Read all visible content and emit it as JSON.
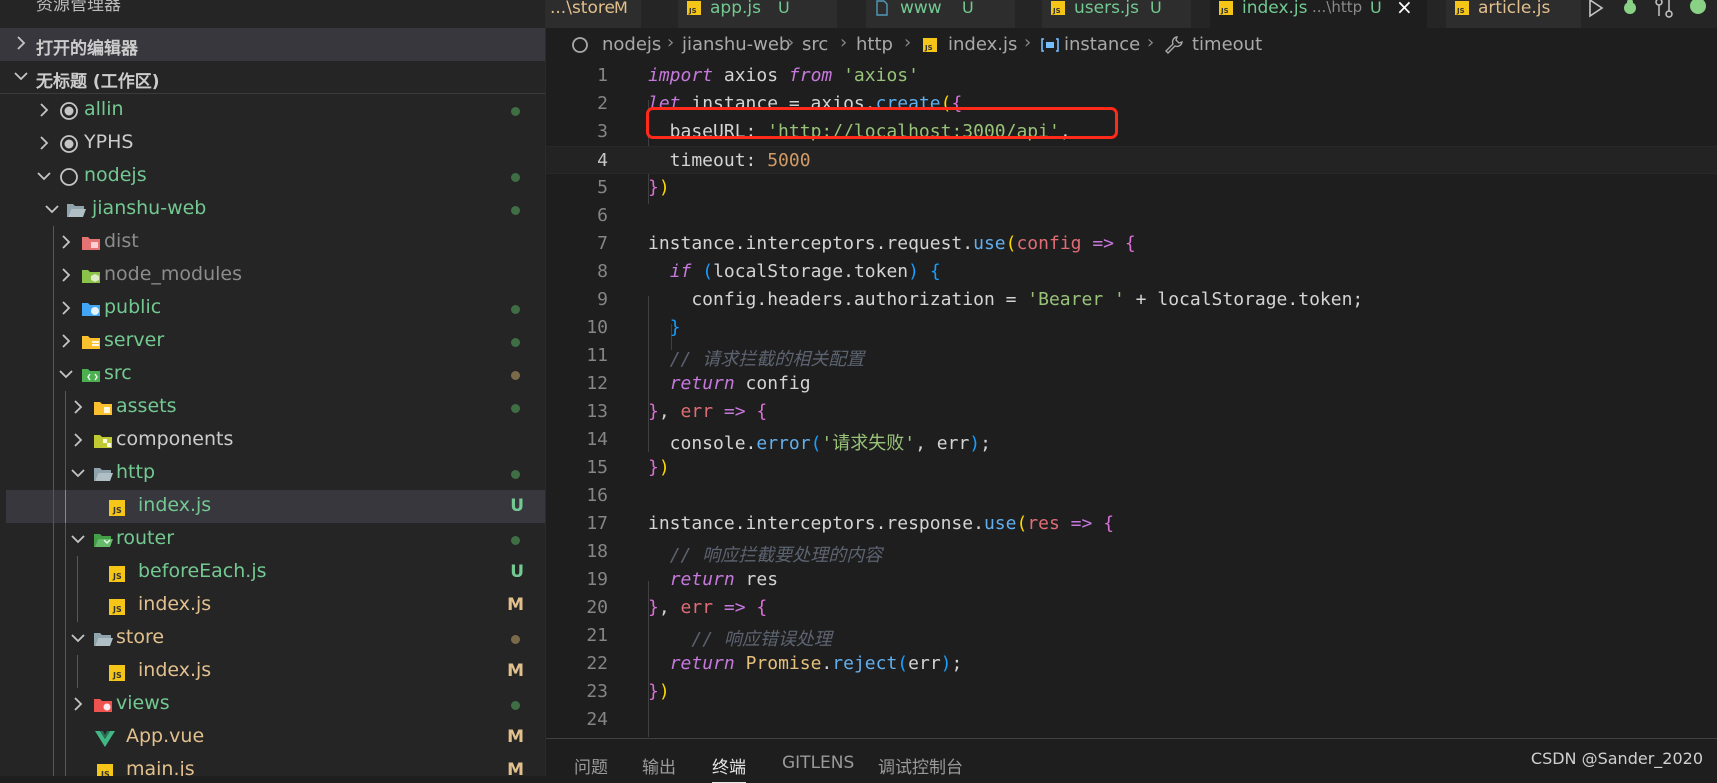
{
  "explorer": {
    "title": "资源管理器",
    "more": "···",
    "section_open": "打开的编辑器",
    "section_workspace": "无标题 (工作区)"
  },
  "tree": [
    {
      "name": "allin",
      "status": "",
      "dot": true
    },
    {
      "name": "YPHS",
      "status": "",
      "dot": false
    },
    {
      "name": "nodejs",
      "status": "",
      "dot": true
    },
    {
      "name": "jianshu-web",
      "status": "",
      "dot": true
    },
    {
      "name": "dist",
      "status": "",
      "dot": false
    },
    {
      "name": "node_modules",
      "status": "",
      "dot": false
    },
    {
      "name": "public",
      "status": "",
      "dot": true
    },
    {
      "name": "server",
      "status": "",
      "dot": true
    },
    {
      "name": "src",
      "status": "",
      "dot": true
    },
    {
      "name": "assets",
      "status": "",
      "dot": true
    },
    {
      "name": "components",
      "status": "",
      "dot": false
    },
    {
      "name": "http",
      "status": "",
      "dot": true
    },
    {
      "name": "index.js",
      "status": "U",
      "dot": false
    },
    {
      "name": "router",
      "status": "",
      "dot": true
    },
    {
      "name": "beforeEach.js",
      "status": "U",
      "dot": false
    },
    {
      "name": "index.js",
      "status": "M",
      "dot": false
    },
    {
      "name": "store",
      "status": "",
      "dot": true
    },
    {
      "name": "index.js",
      "status": "M",
      "dot": false
    },
    {
      "name": "views",
      "status": "",
      "dot": true
    },
    {
      "name": "App.vue",
      "status": "M",
      "dot": false
    },
    {
      "name": "main.js",
      "status": "M",
      "dot": false
    }
  ],
  "tabs": [
    {
      "name": "...\\store",
      "status": "M"
    },
    {
      "name": "app.js",
      "status": "U"
    },
    {
      "name": "www",
      "status": "U"
    },
    {
      "name": "users.js",
      "status": "U"
    },
    {
      "name": "index.js",
      "sub": "...\\http",
      "status": "U",
      "close": "×"
    },
    {
      "name": "article.js",
      "status": ""
    }
  ],
  "breadcrumb": [
    "nodejs",
    "jianshu-web",
    "src",
    "http",
    "index.js",
    "instance",
    "timeout"
  ],
  "code": {
    "l3_value": "'http://localhost:3000/api'",
    "l4_value": "5000",
    "l9_bearer": "'Bearer '",
    "l11_comment": "// 请求拦截的相关配置",
    "l14_message": "'请求失败'",
    "l18_comment": "// 响应拦截要处理的内容",
    "l21_comment": "// 响应错误处理"
  },
  "panel": {
    "tabs": [
      "问题",
      "输出",
      "终端",
      "GITLENS",
      "调试控制台"
    ],
    "active": "终端",
    "watermark": "CSDN @Sander_2020"
  },
  "colors": {
    "highlight_box": "#ff2a1a",
    "git_untracked": "#73c991",
    "git_modified": "#e2c08d"
  }
}
